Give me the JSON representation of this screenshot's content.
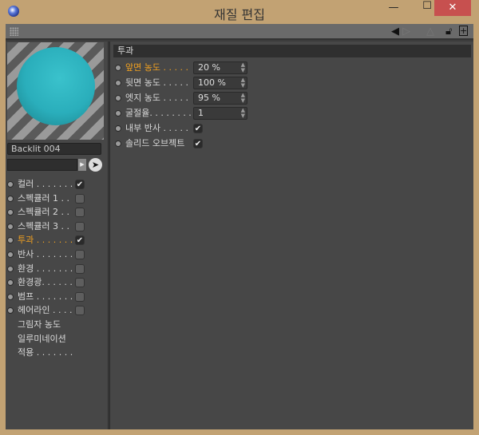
{
  "window": {
    "title": "재질 편집",
    "minimize": "—",
    "maximize": "☐",
    "close": "✕"
  },
  "material": {
    "name": "Backlit 004"
  },
  "channels": [
    {
      "label": "컬러 . . . . . . . .",
      "checked": true,
      "dot": true,
      "active": false
    },
    {
      "label": "스펙큘러 1 . .",
      "checked": false,
      "dot": true,
      "active": false
    },
    {
      "label": "스펙큘러 2 . .",
      "checked": false,
      "dot": true,
      "active": false
    },
    {
      "label": "스펙큘러 3 . .",
      "checked": false,
      "dot": true,
      "active": false
    },
    {
      "label": "투과 . . . . . . . .",
      "checked": true,
      "dot": true,
      "active": true
    },
    {
      "label": "반사 . . . . . . . .",
      "checked": false,
      "dot": true,
      "active": false
    },
    {
      "label": "환경 . . . . . . . .",
      "checked": false,
      "dot": true,
      "active": false
    },
    {
      "label": "환경광. . . . . . .",
      "checked": false,
      "dot": true,
      "active": false
    },
    {
      "label": "범프 . . . . . . . .",
      "checked": false,
      "dot": true,
      "active": false
    },
    {
      "label": "헤어라인 . . . .",
      "checked": false,
      "dot": true,
      "active": false
    },
    {
      "label": "그림자 농도",
      "checked": null,
      "dot": false,
      "active": false
    },
    {
      "label": "일루미네이션",
      "checked": null,
      "dot": false,
      "active": false
    },
    {
      "label": "적용 . . . . . . .",
      "checked": null,
      "dot": false,
      "active": false
    }
  ],
  "section": {
    "title": "투과"
  },
  "params": [
    {
      "label": "앞면 농도 . . . . .",
      "value": "20 %",
      "type": "number",
      "active": true
    },
    {
      "label": "뒷면 농도 . . . . .",
      "value": "100 %",
      "type": "number",
      "active": false
    },
    {
      "label": "엣지 농도 . . . . .",
      "value": "95 %",
      "type": "number",
      "active": false
    },
    {
      "label": "굴절율. . . . . . . . .",
      "value": "1",
      "type": "number",
      "active": false
    },
    {
      "label": "내부 반사 . . . . .",
      "value": "✔",
      "type": "check",
      "active": false
    },
    {
      "label": "솔리드 오브젝트",
      "value": "✔",
      "type": "check",
      "active": false
    }
  ]
}
